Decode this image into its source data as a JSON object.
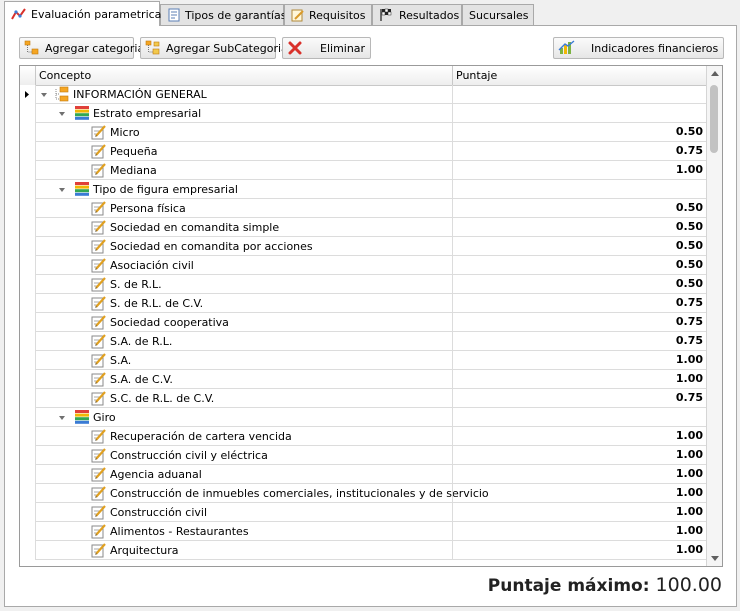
{
  "tabs": [
    {
      "label": "Evaluación parametrica",
      "icon": "evaluation-icon"
    },
    {
      "label": "Tipos de garantías",
      "icon": "guarantees-icon"
    },
    {
      "label": "Requisitos",
      "icon": "requirements-icon"
    },
    {
      "label": "Resultados",
      "icon": "results-flag-icon"
    },
    {
      "label": "Sucursales",
      "icon": ""
    }
  ],
  "toolbar": {
    "add_category": "Agregar categoria",
    "add_subcategory": "Agregar SubCategoria",
    "delete": "Eliminar",
    "financial_indicators": "Indicadores financieros"
  },
  "grid": {
    "col_concept": "Concepto",
    "col_score": "Puntaje",
    "rows": [
      {
        "level": 0,
        "type": "root",
        "label": "INFORMACIÓN GENERAL",
        "score": ""
      },
      {
        "level": 1,
        "type": "category",
        "label": "Estrato empresarial",
        "score": ""
      },
      {
        "level": 2,
        "type": "item",
        "label": "Micro",
        "score": "0.50"
      },
      {
        "level": 2,
        "type": "item",
        "label": "Pequeña",
        "score": "0.75"
      },
      {
        "level": 2,
        "type": "item",
        "label": "Mediana",
        "score": "1.00"
      },
      {
        "level": 1,
        "type": "category",
        "label": "Tipo de figura empresarial",
        "score": ""
      },
      {
        "level": 2,
        "type": "item",
        "label": "Persona física",
        "score": "0.50"
      },
      {
        "level": 2,
        "type": "item",
        "label": "Sociedad en comandita simple",
        "score": "0.50"
      },
      {
        "level": 2,
        "type": "item",
        "label": "Sociedad en comandita por acciones",
        "score": "0.50"
      },
      {
        "level": 2,
        "type": "item",
        "label": "Asociación civil",
        "score": "0.50"
      },
      {
        "level": 2,
        "type": "item",
        "label": "S. de R.L.",
        "score": "0.50"
      },
      {
        "level": 2,
        "type": "item",
        "label": "S. de R.L. de C.V.",
        "score": "0.75"
      },
      {
        "level": 2,
        "type": "item",
        "label": "Sociedad cooperativa",
        "score": "0.75"
      },
      {
        "level": 2,
        "type": "item",
        "label": "S.A. de R.L.",
        "score": "0.75"
      },
      {
        "level": 2,
        "type": "item",
        "label": "S.A.",
        "score": "1.00"
      },
      {
        "level": 2,
        "type": "item",
        "label": "S.A. de C.V.",
        "score": "1.00"
      },
      {
        "level": 2,
        "type": "item",
        "label": "S.C. de R.L. de C.V.",
        "score": "0.75"
      },
      {
        "level": 1,
        "type": "category",
        "label": "Giro",
        "score": ""
      },
      {
        "level": 2,
        "type": "item",
        "label": "Recuperación de cartera vencida",
        "score": "1.00"
      },
      {
        "level": 2,
        "type": "item",
        "label": "Construcción civil y eléctrica",
        "score": "1.00"
      },
      {
        "level": 2,
        "type": "item",
        "label": "Agencia aduanal",
        "score": "1.00"
      },
      {
        "level": 2,
        "type": "item",
        "label": "Construcción de inmuebles comerciales, institucionales y de servicio",
        "score": "1.00"
      },
      {
        "level": 2,
        "type": "item",
        "label": "Construcción civil",
        "score": "1.00"
      },
      {
        "level": 2,
        "type": "item",
        "label": "Alimentos - Restaurantes",
        "score": "1.00"
      },
      {
        "level": 2,
        "type": "item",
        "label": "Arquitectura",
        "score": "1.00"
      }
    ]
  },
  "footer": {
    "label": "Puntaje máximo:",
    "value": "100.00"
  },
  "colors": {
    "category_icon": [
      "#e0403a",
      "#f2b705",
      "#33a852",
      "#3a7bd5"
    ],
    "folder": "#f5a623",
    "delete": "#d9312b"
  }
}
